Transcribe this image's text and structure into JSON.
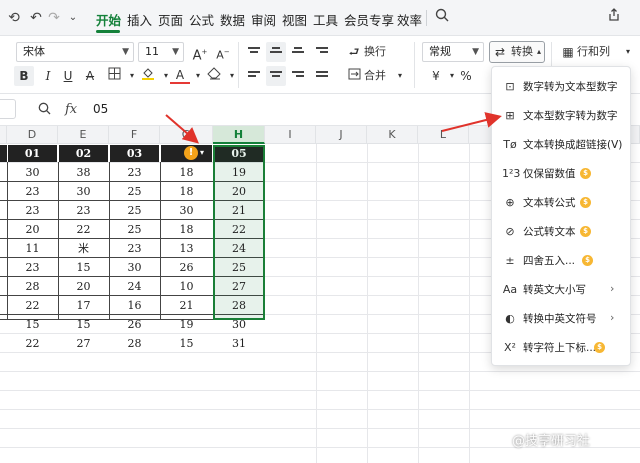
{
  "menu": {
    "tabs": [
      "开始",
      "插入",
      "页面",
      "公式",
      "数据",
      "审阅",
      "视图",
      "工具",
      "会员专享",
      "效率"
    ],
    "active_tab": "开始"
  },
  "ribbon": {
    "font_name": "宋体",
    "font_size": "11",
    "wrap_label": "换行",
    "merge_label": "合并",
    "number_format": "常规",
    "convert_label": "转换",
    "row_col_label": "行和列",
    "currency_symbol": "¥",
    "percent_symbol": "%",
    "bold": "B",
    "italic": "I",
    "underline": "U",
    "strike": "A",
    "font_color": "A",
    "grow": "A",
    "shrink": "A"
  },
  "formula_bar": {
    "fx_label": "fx",
    "value": "05"
  },
  "grid": {
    "columns": [
      "D",
      "E",
      "F",
      "G",
      "H",
      "I",
      "J",
      "K",
      "L"
    ],
    "selected_column": "H",
    "table_header": [
      "01",
      "02",
      "03",
      "",
      "05"
    ],
    "rows": [
      [
        "30",
        "38",
        "23",
        "18",
        "19"
      ],
      [
        "23",
        "30",
        "25",
        "18",
        "20"
      ],
      [
        "23",
        "23",
        "25",
        "30",
        "21"
      ],
      [
        "20",
        "22",
        "25",
        "18",
        "22"
      ],
      [
        "11",
        "米",
        "23",
        "13",
        "24"
      ],
      [
        "23",
        "15",
        "30",
        "26",
        "25"
      ],
      [
        "28",
        "20",
        "24",
        "10",
        "27"
      ],
      [
        "22",
        "17",
        "16",
        "21",
        "28"
      ],
      [
        "15",
        "15",
        "26",
        "19",
        "30"
      ],
      [
        "22",
        "27",
        "28",
        "15",
        "31"
      ]
    ],
    "warning_glyph": "!"
  },
  "convert_menu": {
    "items": [
      {
        "label": "数字转为文本型数字",
        "icon": "number-to-text-icon",
        "glyph": "⊡",
        "premium": false,
        "submenu": false
      },
      {
        "label": "文本型数字转为数字",
        "icon": "text-to-number-icon",
        "glyph": "⊞",
        "premium": false,
        "submenu": false
      },
      {
        "label": "文本转换成超链接(V)",
        "icon": "hyperlink-icon",
        "glyph": "Tø",
        "premium": false,
        "submenu": false
      },
      {
        "label": "仅保留数值",
        "icon": "keep-values-icon",
        "glyph": "1²3",
        "premium": true,
        "submenu": false
      },
      {
        "label": "文本转公式",
        "icon": "text-to-formula-icon",
        "glyph": "⊕",
        "premium": true,
        "submenu": false
      },
      {
        "label": "公式转文本",
        "icon": "formula-to-text-icon",
        "glyph": "⊘",
        "premium": true,
        "submenu": false
      },
      {
        "label": "四舍五入...",
        "icon": "round-icon",
        "glyph": "±",
        "premium": true,
        "submenu": false
      },
      {
        "label": "转英文大小写",
        "icon": "case-icon",
        "glyph": "Aa",
        "premium": false,
        "submenu": true
      },
      {
        "label": "转换中英文符号",
        "icon": "punctuation-icon",
        "glyph": "◐",
        "premium": false,
        "submenu": true
      },
      {
        "label": "转字符上下标...",
        "icon": "superscript-icon",
        "glyph": "X²",
        "premium": true,
        "submenu": false
      }
    ],
    "coin_glyph": "$",
    "chevron_glyph": "›"
  },
  "colors": {
    "accent": "#14813a",
    "header_black": "#222222",
    "warning": "#f3a21a",
    "arrow_red": "#e0332b",
    "coin": "#f7b733"
  },
  "watermark": "@技享研习社"
}
